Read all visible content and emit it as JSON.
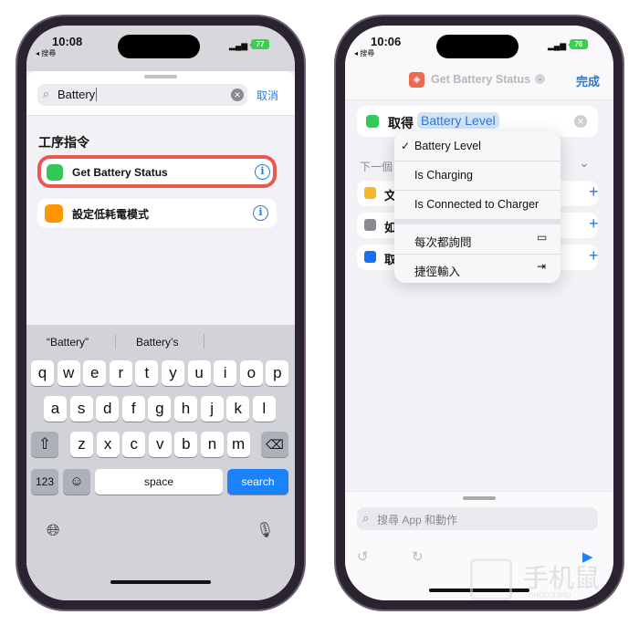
{
  "left": {
    "status": {
      "time": "10:08",
      "back": "◂ 搜尋",
      "battery": "77"
    },
    "search": {
      "value": "Battery",
      "cancel": "取消"
    },
    "section": "工序指令",
    "results": [
      {
        "label": "Get Battery Status",
        "icon_color": "#34c759",
        "highlighted": true
      },
      {
        "label": "設定低耗電模式",
        "icon_color": "#ff9500"
      }
    ],
    "keyboard": {
      "suggestions": [
        "“Battery”",
        "Battery’s",
        ""
      ],
      "row1": [
        "q",
        "w",
        "e",
        "r",
        "t",
        "y",
        "u",
        "i",
        "o",
        "p"
      ],
      "row2": [
        "a",
        "s",
        "d",
        "f",
        "g",
        "h",
        "j",
        "k",
        "l"
      ],
      "row3": [
        "z",
        "x",
        "c",
        "v",
        "b",
        "n",
        "m"
      ],
      "numbers": "123",
      "space": "space",
      "search": "search"
    }
  },
  "right": {
    "status": {
      "time": "10:06",
      "back": "◂ 搜尋",
      "battery": "76"
    },
    "nav": {
      "title": "Get Battery Status",
      "done": "完成"
    },
    "action": {
      "verb": "取得",
      "param": "Battery Level"
    },
    "next_label": "下一個",
    "suggestions": [
      "文",
      "如",
      "取"
    ],
    "menu": {
      "items": [
        {
          "label": "Battery Level",
          "checked": true
        },
        {
          "label": "Is Charging"
        },
        {
          "label": "Is Connected to Charger"
        }
      ],
      "extra": [
        {
          "label": "每次都詢問",
          "icon": "message-icon"
        },
        {
          "label": "捷徑輸入",
          "icon": "input-icon"
        }
      ]
    },
    "search_placeholder": "搜尋 App 和動作"
  },
  "watermark": {
    "brand": "手机鼠",
    "sub": "SHOUJISHU"
  }
}
